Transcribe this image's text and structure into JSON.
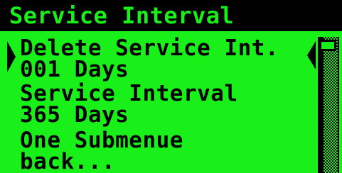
{
  "screen": {
    "title": "Service Interval",
    "colors": {
      "background": "#19f019",
      "foreground": "#000000"
    }
  },
  "menu": {
    "items": [
      {
        "line1": "Delete Service Int.",
        "line2": "001 Days",
        "selected": true
      },
      {
        "line1": "Service Interval",
        "line2": "365 Days",
        "selected": false
      },
      {
        "line1": "One Submenue",
        "line2": "back...",
        "selected": false
      }
    ]
  },
  "icons": {
    "selection_left": "selection-arrow-left-icon",
    "selection_right": "selection-arrow-right-icon"
  },
  "scrollbar": {
    "position": 0
  }
}
